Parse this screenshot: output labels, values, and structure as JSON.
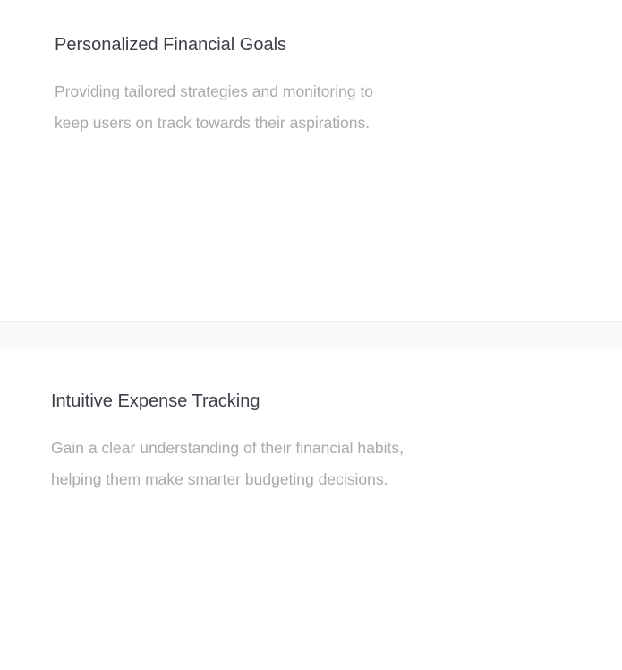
{
  "features": [
    {
      "title": "Personalized Financial Goals",
      "description_line1": "Providing tailored strategies and monitoring to",
      "description_line2": "keep users on track towards their aspirations."
    },
    {
      "title": "Intuitive Expense Tracking",
      "description_line1": "Gain a clear understanding of their financial habits,",
      "description_line2": "helping them make smarter budgeting decisions."
    }
  ],
  "colors": {
    "title": "#3d3e4a",
    "description": "#a9a9ae",
    "background": "#ffffff",
    "divider": "#f9f9fa"
  }
}
